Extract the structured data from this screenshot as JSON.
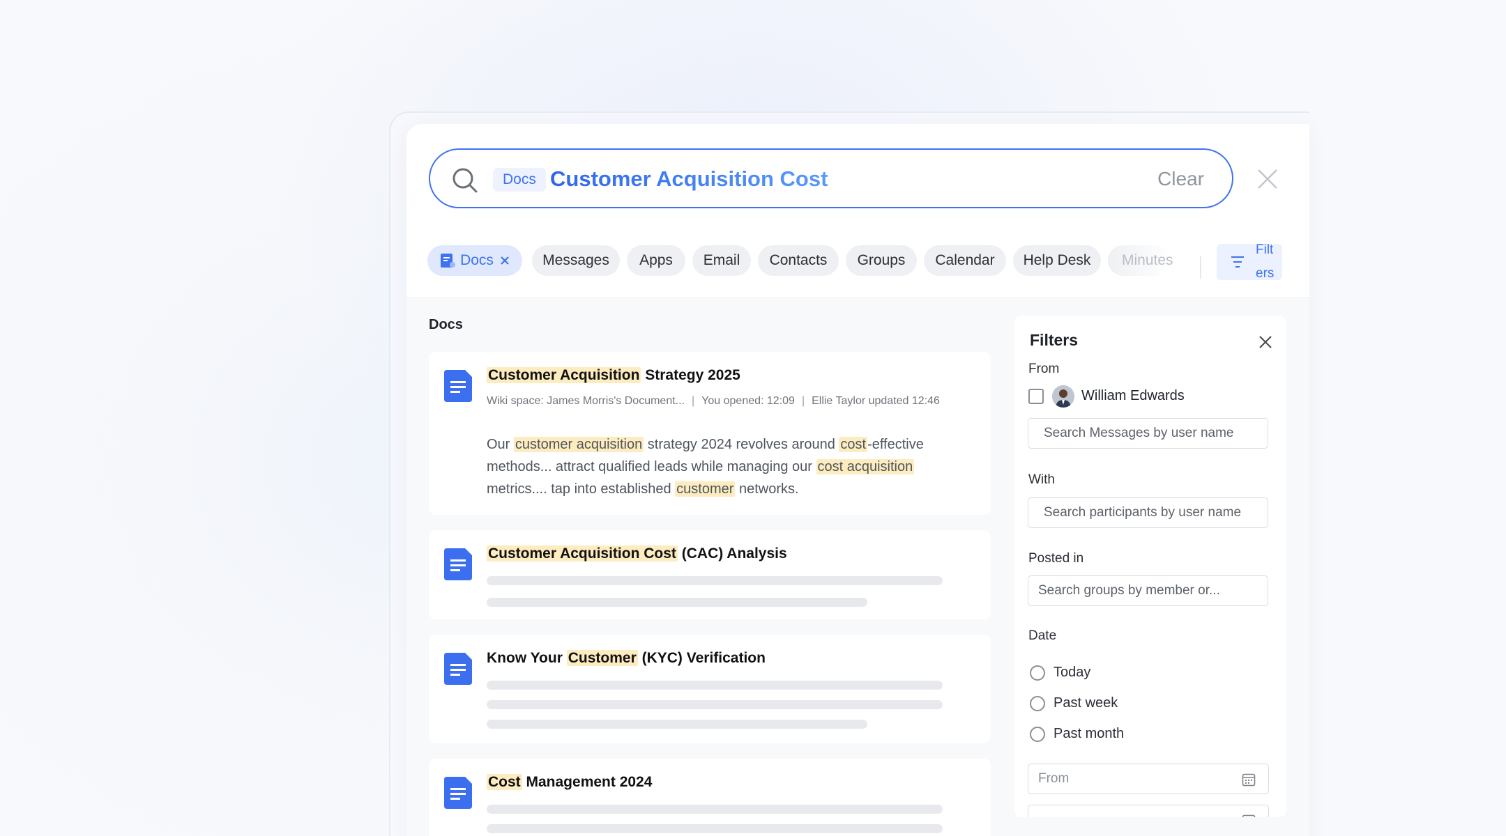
{
  "search": {
    "scope_chip": "Docs",
    "query": "Customer Acquisition Cost",
    "clear_label": "Clear"
  },
  "categories": [
    {
      "label": "Docs",
      "active": true
    },
    {
      "label": "Messages"
    },
    {
      "label": "Apps"
    },
    {
      "label": "Email"
    },
    {
      "label": "Contacts"
    },
    {
      "label": "Groups"
    },
    {
      "label": "Calendar"
    },
    {
      "label": "Help Desk"
    },
    {
      "label": "Minutes"
    }
  ],
  "filters_button_label": "Filters",
  "results": {
    "section_title": "Docs",
    "items": [
      {
        "title_parts": [
          {
            "text": "Customer Acquisition",
            "hl": true
          },
          {
            "text": " Strategy 2025",
            "hl": false
          }
        ],
        "meta_space": "Wiki space: James Morris's Document...",
        "meta_opened": "You opened: 12:09",
        "meta_updated": "Ellie Taylor updated 12:46",
        "snippet_parts": [
          {
            "text": "Our ",
            "hl": false
          },
          {
            "text": "customer acquisition",
            "hl": true
          },
          {
            "text": " strategy 2024 revolves around ",
            "hl": false
          },
          {
            "text": "cost",
            "hl": true
          },
          {
            "text": "-effective methods... attract qualified leads while managing our ",
            "hl": false
          },
          {
            "text": "cost acquisition",
            "hl": true
          },
          {
            "text": " metrics.... tap into established ",
            "hl": false
          },
          {
            "text": "customer",
            "hl": true
          },
          {
            "text": " networks.",
            "hl": false
          }
        ]
      },
      {
        "title_parts": [
          {
            "text": "Customer Acquisition Cost",
            "hl": true
          },
          {
            "text": " (CAC) Analysis",
            "hl": false
          }
        ]
      },
      {
        "title_parts": [
          {
            "text": "Know Your ",
            "hl": false
          },
          {
            "text": "Customer",
            "hl": true
          },
          {
            "text": " (KYC) Verification",
            "hl": false
          }
        ]
      },
      {
        "title_parts": [
          {
            "text": "Cost",
            "hl": true
          },
          {
            "text": " Management 2024",
            "hl": false
          }
        ]
      }
    ]
  },
  "filters": {
    "title": "Filters",
    "from_label": "From",
    "from_user": "William Edwards",
    "from_placeholder": "Search Messages by user name",
    "with_label": "With",
    "with_placeholder": "Search participants by user name",
    "posted_label": "Posted in",
    "posted_placeholder": "Search groups by member or...",
    "date_label": "Date",
    "date_options": [
      "Today",
      "Past week",
      "Past month"
    ],
    "date_from_placeholder": "From"
  },
  "colors": {
    "accent": "#3f72f0",
    "highlight": "#fdecc0",
    "chip_bg": "#eef0f3"
  }
}
